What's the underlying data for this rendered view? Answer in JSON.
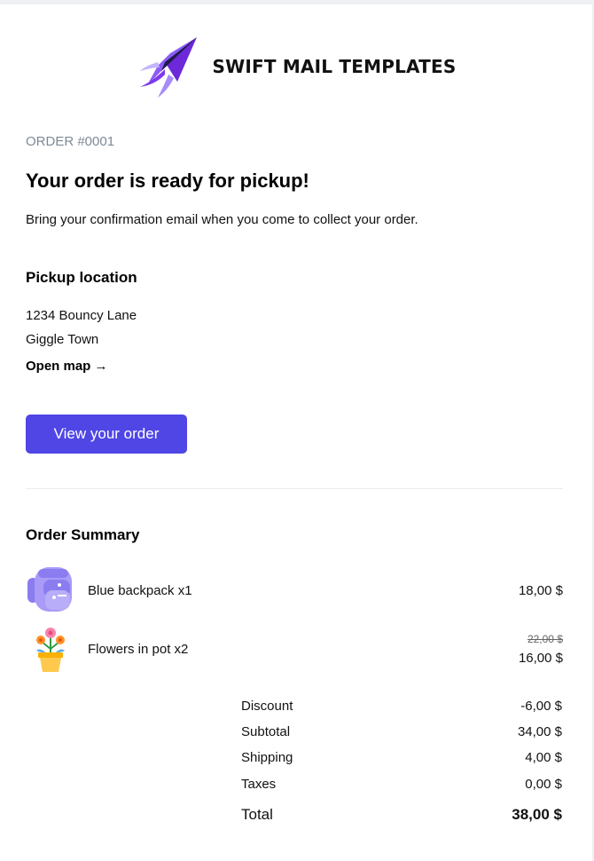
{
  "brand": {
    "name": "SWIFT MAIL TEMPLATES",
    "logo_icon": "paper-plane-logo",
    "colors": {
      "purple_dark": "#4c1d95",
      "purple": "#7c3aed",
      "purple_light": "#a78bfa"
    }
  },
  "order": {
    "number_label": "ORDER #0001",
    "headline": "Your order is ready for pickup!",
    "subtext": "Bring your confirmation email when you come to collect your order."
  },
  "pickup": {
    "title": "Pickup location",
    "address_line1": "1234 Bouncy Lane",
    "address_line2": "Giggle Town",
    "map_link": "Open map →"
  },
  "cta": {
    "label": "View your order",
    "color": "#4f46e5"
  },
  "summary": {
    "title": "Order Summary",
    "items": [
      {
        "name": "Blue backpack x1",
        "price": "18,00 $",
        "icon": "backpack-icon"
      },
      {
        "name": "Flowers in pot x2",
        "old_price": "22,00 $",
        "price": "16,00 $",
        "icon": "flower-pot-icon"
      }
    ],
    "totals": [
      {
        "label": "Discount",
        "value": "-6,00 $"
      },
      {
        "label": "Subtotal",
        "value": "34,00 $"
      },
      {
        "label": "Shipping",
        "value": "4,00 $"
      },
      {
        "label": "Taxes",
        "value": "0,00 $"
      }
    ],
    "grand_total": {
      "label": "Total",
      "value": "38,00 $"
    }
  }
}
